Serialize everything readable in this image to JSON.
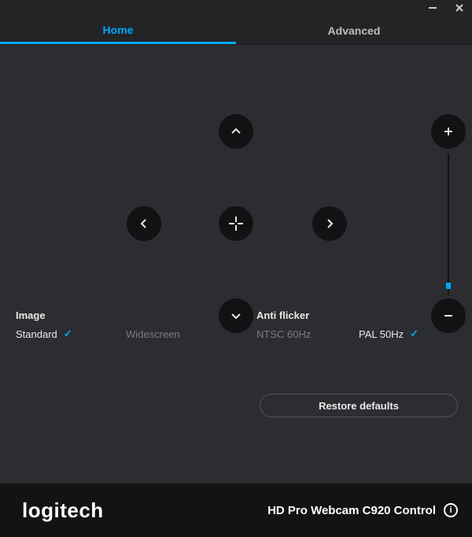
{
  "tabs": {
    "home": "Home",
    "advanced": "Advanced",
    "active": "home"
  },
  "image_section": {
    "label": "Image",
    "options": {
      "standard": "Standard",
      "widescreen": "Widescreen"
    },
    "selected": "standard"
  },
  "antiflicker_section": {
    "label": "Anti flicker",
    "options": {
      "ntsc": "NTSC 60Hz",
      "pal": "PAL 50Hz"
    },
    "selected": "pal"
  },
  "restore_label": "Restore defaults",
  "footer": {
    "logo": "logitech",
    "product": "HD Pro Webcam C920 Control"
  },
  "icons": {
    "pan_up": "chevron-up",
    "pan_down": "chevron-down",
    "pan_left": "chevron-left",
    "pan_right": "chevron-right",
    "pan_center": "recenter-crosshair",
    "zoom_in": "plus",
    "zoom_out": "minus",
    "minimize": "minimize",
    "close": "close",
    "info": "info"
  },
  "zoom": {
    "min": 0,
    "max": 100,
    "value": 5
  },
  "colors": {
    "accent": "#00a7ff",
    "bg": "#2b2d30",
    "footer": "#121314"
  }
}
